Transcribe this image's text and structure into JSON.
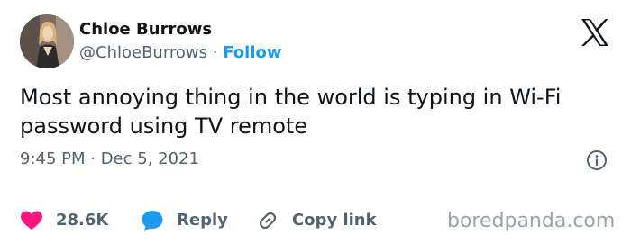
{
  "user": {
    "name": "Chloe Burrows",
    "handle": "@ChloeBurrows",
    "separator": "·",
    "follow_label": "Follow"
  },
  "tweet": {
    "text": "Most annoying thing in the world is typing in Wi-Fi password using TV remote",
    "timestamp": "9:45 PM · Dec 5, 2021"
  },
  "actions": {
    "likes": "28.6K",
    "reply_label": "Reply",
    "copy_label": "Copy link"
  },
  "watermark": "boredpanda.com",
  "colors": {
    "accent": "#1d9bf0",
    "like": "#f91880",
    "text": "#0f1419",
    "muted": "#536471"
  },
  "icons": [
    "x-logo-icon",
    "info-icon",
    "heart-icon",
    "reply-bubble-icon",
    "link-icon"
  ]
}
